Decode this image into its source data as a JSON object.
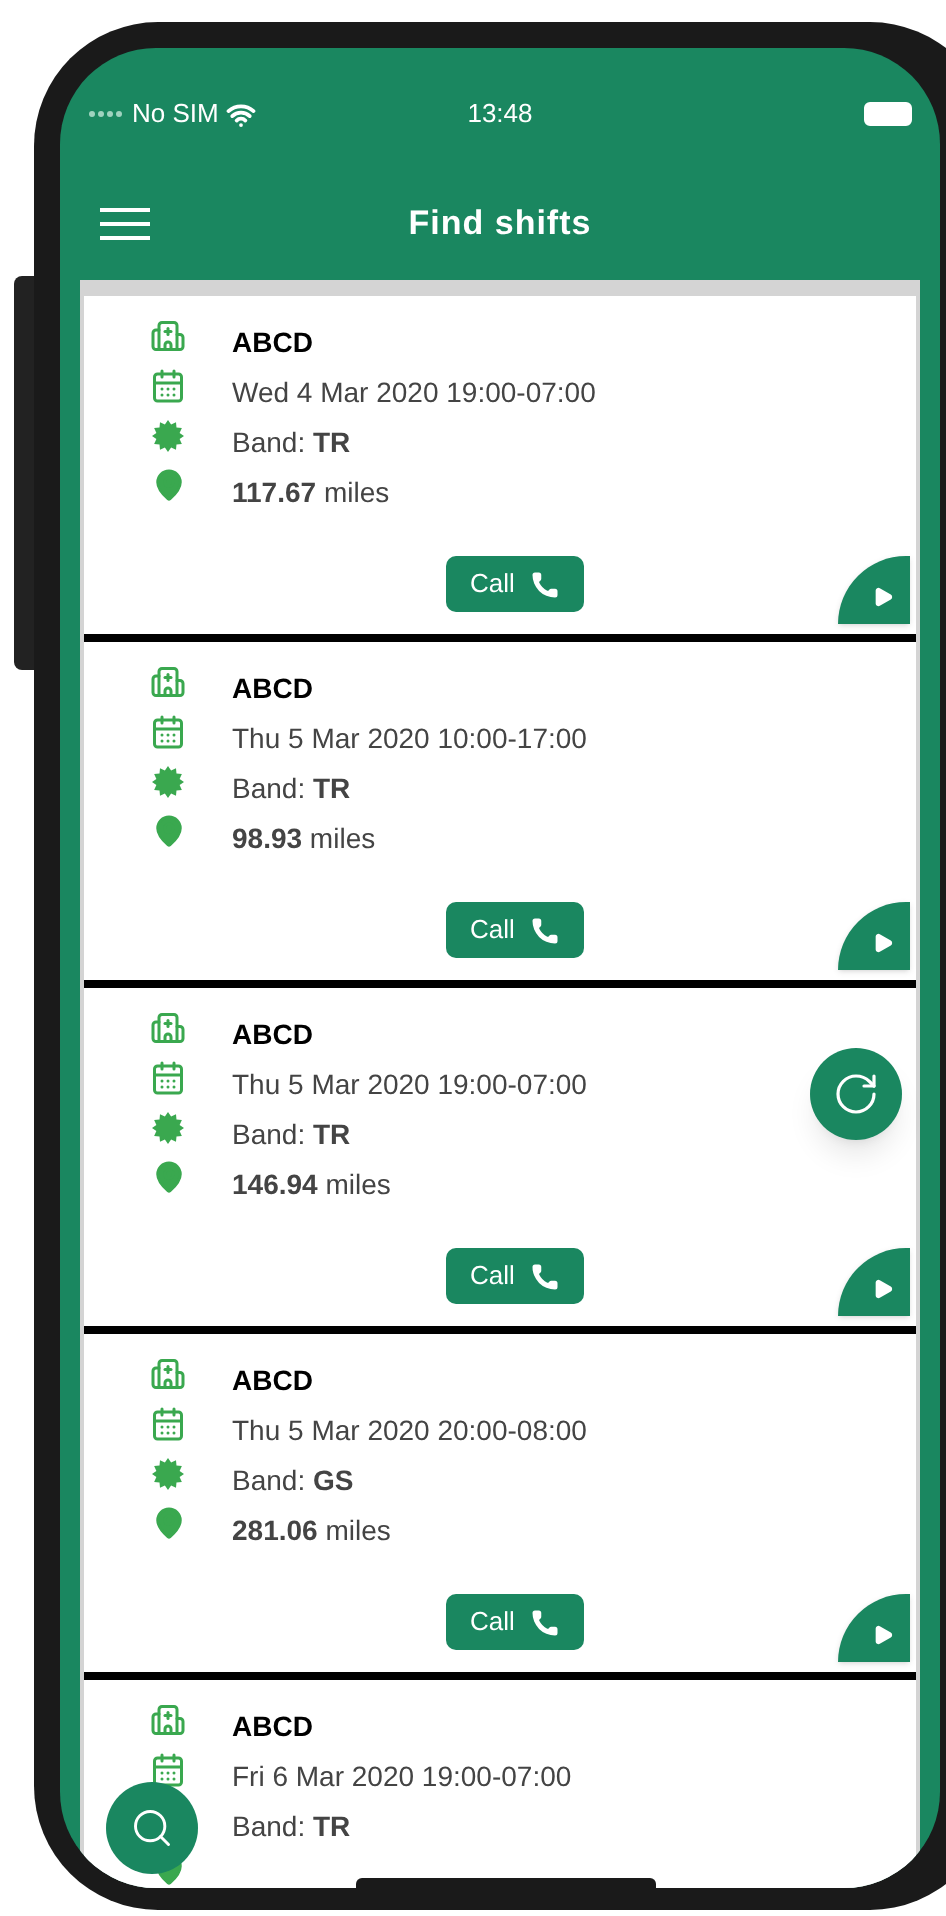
{
  "status_bar": {
    "carrier": "No SIM",
    "time": "13:48"
  },
  "header": {
    "title": "Find shifts"
  },
  "shifts": [
    {
      "name": "ABCD",
      "date": "Wed 4 Mar 2020 19:00-07:00",
      "band": "Band: **TR**",
      "distance": "**117.67** miles",
      "call": "Call"
    },
    {
      "name": "ABCD",
      "date": "Thu 5 Mar 2020 10:00-17:00",
      "band": "Band: **TR**",
      "distance": "**98.93** miles",
      "call": "Call"
    },
    {
      "name": "ABCD",
      "date": "Thu 5 Mar 2020 19:00-07:00",
      "band": "Band: **TR**",
      "distance": "**146.94** miles",
      "call": "Call"
    },
    {
      "name": "ABCD",
      "date": "Thu 5 Mar 2020 20:00-08:00",
      "band": "Band: **GS**",
      "distance": "**281.06** miles",
      "call": "Call"
    },
    {
      "name": "ABCD",
      "date": "Fri 6 Mar 2020 19:00-07:00",
      "band": "Band: **TR**"
    }
  ]
}
